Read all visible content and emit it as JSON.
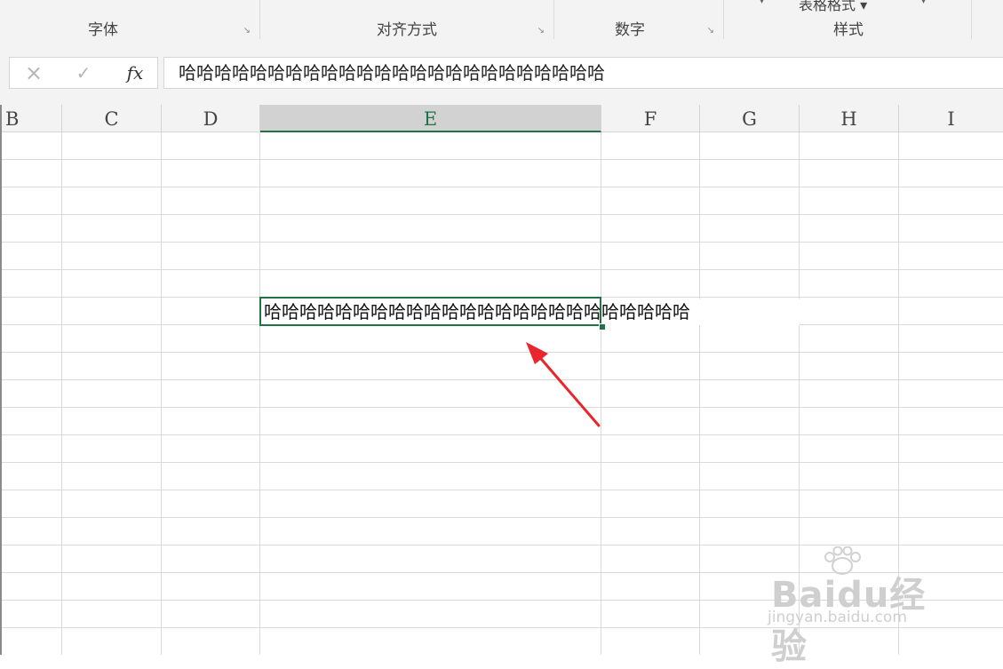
{
  "ribbon": {
    "groups": [
      {
        "label": "字体",
        "launcher": "↘"
      },
      {
        "label": "对齐方式",
        "launcher": "↘"
      },
      {
        "label": "数字",
        "launcher": "↘"
      },
      {
        "label": "样式",
        "partial_top_label": "表格格式"
      }
    ]
  },
  "formula_bar": {
    "cancel_icon": "×",
    "enter_icon": "✓",
    "fx_label": "fx",
    "content": "哈哈哈哈哈哈哈哈哈哈哈哈哈哈哈哈哈哈哈哈哈哈哈哈"
  },
  "columns": [
    "B",
    "C",
    "D",
    "E",
    "F",
    "G",
    "H",
    "I"
  ],
  "selected_column": "E",
  "active_cell": {
    "value": "哈哈哈哈哈哈哈哈哈哈哈哈哈哈哈哈哈哈哈哈哈哈哈哈"
  },
  "watermark": {
    "logo": "Baidu经验",
    "url": "jingyan.baidu.com"
  },
  "colors": {
    "accent": "#217346",
    "arrow": "#e8262b"
  }
}
